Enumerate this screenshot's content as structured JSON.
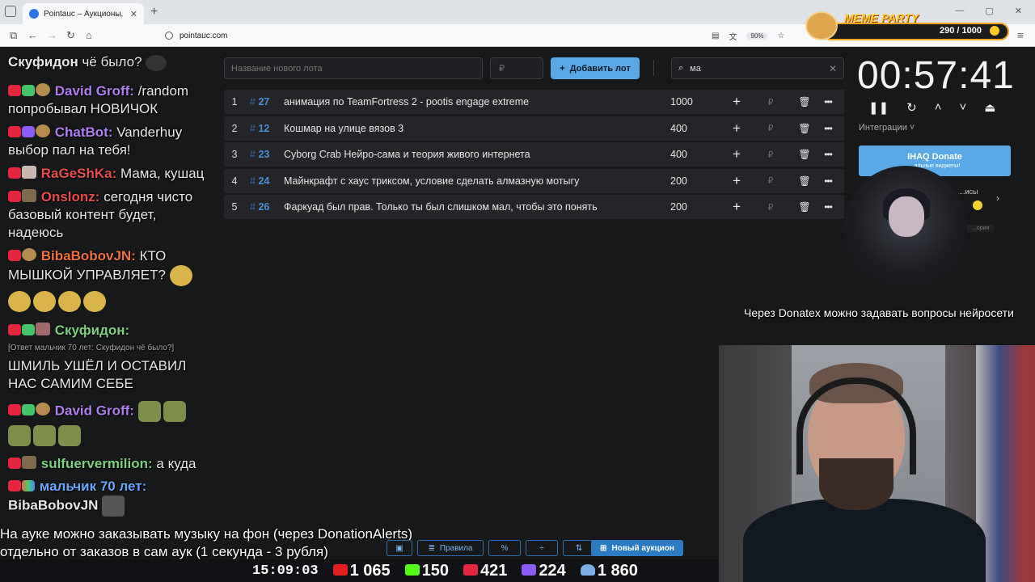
{
  "browser": {
    "tab_title": "Pointauc – Аукционы, лотереи",
    "url": "pointauc.com",
    "zoom": "90%"
  },
  "meme_party": {
    "title": "MEME PARTY",
    "progress": "290 / 1000",
    "progress_value": 0.29
  },
  "chat": [
    {
      "nick": "Скуфидон",
      "text": "чё было?",
      "nick_color": "#ffffff"
    },
    {
      "nick": "David Groff:",
      "text": "/random попробывал НОВИЧОК",
      "nick_color": "#b07ef0"
    },
    {
      "nick": "ChatBot:",
      "text": "Vanderhuy выбор пал на тебя!",
      "nick_color": "#b07ef0"
    },
    {
      "nick": "RaGeShKa:",
      "text": "Мама, кушац",
      "nick_color": "#e64d4d"
    },
    {
      "nick": "Onslonz:",
      "text": "сегодня чисто базовый контент будет, надеюсь",
      "nick_color": "#e64d4d"
    },
    {
      "nick": "BibaBobovJN:",
      "text": "КТО МЫШКОЙ УПРАВЛЯЕТ?",
      "nick_color": "#f07040"
    },
    {
      "nick": "Скуфидон:",
      "reply": "[Ответ мальчик 70 лет: Скуфидон чё было?]",
      "text": "ШМИЛЬ УШЁЛ И ОСТАВИЛ НАС САМИМ СЕБЕ",
      "nick_color": "#7ed080"
    },
    {
      "nick": "David Groff:",
      "text": "",
      "nick_color": "#b07ef0"
    },
    {
      "nick": "sulfuervermilion:",
      "text": "а куда",
      "nick_color": "#7ed080"
    },
    {
      "nick": "мальчик 70 лет:",
      "text": "BibaBobovJN",
      "nick_color": "#6aa8ff"
    }
  ],
  "form": {
    "lot_placeholder": "Название нового лота",
    "price_placeholder": "₽",
    "add_label": "Добавить лот",
    "search_value": "ма"
  },
  "lots": [
    {
      "index": "1",
      "hash": "#",
      "id": "27",
      "name": "анимация по TeamFortress 2 - pootis engage extreme",
      "amount": "1000"
    },
    {
      "index": "2",
      "hash": "#",
      "id": "12",
      "name": "Кошмар на улице вязов 3",
      "amount": "400"
    },
    {
      "index": "3",
      "hash": "#",
      "id": "23",
      "name": "Cyborg Crab Нейро-сама и теория живого интернета",
      "amount": "400"
    },
    {
      "index": "4",
      "hash": "#",
      "id": "24",
      "name": "Майнкрафт с хаус триксом, условие сделать алмазную мотыгу",
      "amount": "200"
    },
    {
      "index": "5",
      "hash": "#",
      "id": "26",
      "name": "Фаркуад был прав. Только ты был слишком мал, чтобы это понять",
      "amount": "200"
    }
  ],
  "row_currency": "₽",
  "timer": {
    "time": "00:57:41",
    "integrations_label": "Интеграции"
  },
  "ihaq": {
    "label": "IHAQ Donate",
    "sub": "...альные виджеты!"
  },
  "side": {
    "label": "...исы",
    "small": "...ория"
  },
  "donatex_note": "Через Donatex можно задавать вопросы нейросети",
  "music_note": {
    "line1": "На ауке можно заказывать музыку на фон (через DonationAlerts)",
    "line2": "отдельно от заказов в сам аук (1 секунда - 3 рубля)"
  },
  "toolbar": {
    "rules_label": "Правила",
    "new_auction_label": "Новый аукцион"
  },
  "stats": {
    "clock": "15:09:03",
    "youtube": "1 065",
    "kick": "150",
    "live": "421",
    "twitch": "224",
    "viewers": "1 860"
  }
}
